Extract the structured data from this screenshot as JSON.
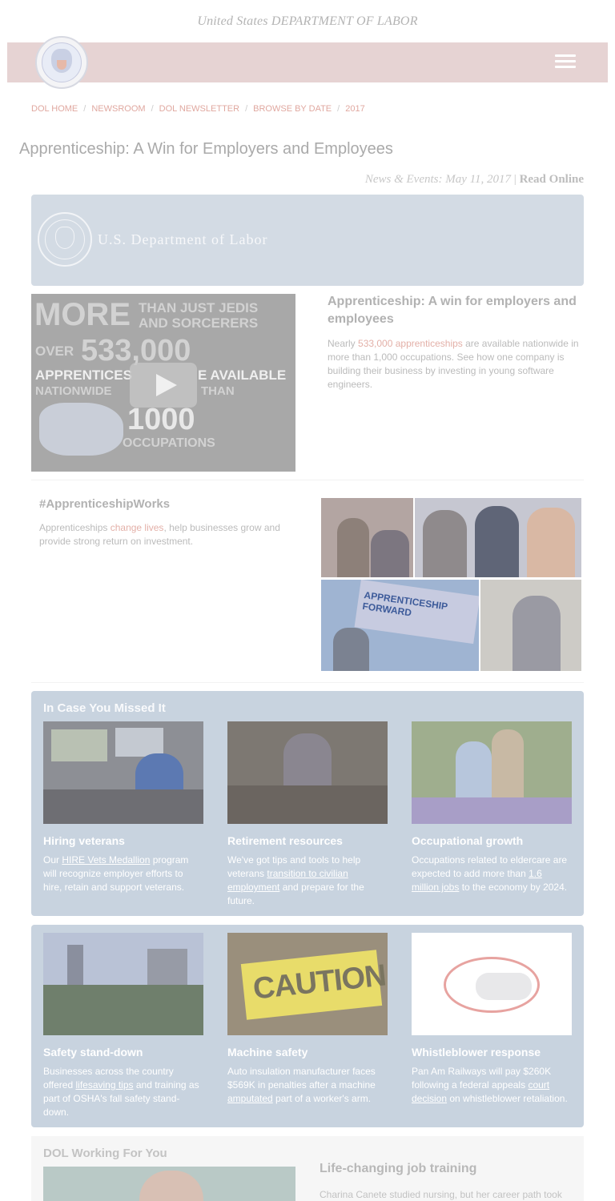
{
  "agency_line": "United States DEPARTMENT OF LABOR",
  "nav": {
    "menu_icon": "hamburger-icon",
    "logo": "dol-seal"
  },
  "breadcrumb": {
    "items": [
      "DOL HOME",
      "NEWSROOM",
      "DOL NEWSLETTER",
      "BROWSE BY DATE",
      "2017"
    ],
    "separator": "/"
  },
  "page_title": "Apprenticeship: A Win for Employers and Employees",
  "news_line": {
    "prefix": "News & Events: May 11, 2017",
    "divider": "|",
    "link": "Read Online"
  },
  "banner": {
    "title": "U.S. Department of Labor"
  },
  "video": {
    "line1": "MORE",
    "line1b": "THAN JUST JEDIS",
    "line1c": "AND SORCERERS",
    "line2a": "OVER",
    "line2b": "533,000",
    "line3": "APPRENTICES",
    "line3b": "E AVAILABLE",
    "line4": "NATIONWIDE",
    "line4b": "THAN",
    "line5": "1000",
    "line6": "OCCUPATIONS",
    "play_icon": "play-icon"
  },
  "feature": {
    "heading": "Apprenticeship: A win for employers and employees",
    "text_before": "Nearly ",
    "link": "533,000 apprenticeships",
    "text_after": " are available nationwide in more than 1,000 occupations. See how one company is building their business by investing in young software engineers."
  },
  "apprenticeship_works": {
    "heading": "#ApprenticeshipWorks",
    "text_before": "Apprenticeships ",
    "link": "change lives",
    "text_after": ", help businesses grow and provide strong return on investment."
  },
  "collage": {
    "sign_text": "APPRENTICESHIP FORWARD"
  },
  "missed": {
    "heading": "In Case You Missed It",
    "cards": [
      {
        "title": "Hiring veterans",
        "p1": "Our ",
        "link": "HIRE Vets Medallion",
        "p2": " program will recognize employer efforts to hire, retain and support veterans."
      },
      {
        "title": "Retirement resources",
        "p1": "We've got tips and tools to help veterans ",
        "link": "transition to civilian employment",
        "p2": " and prepare for the future."
      },
      {
        "title": "Occupational growth",
        "p1": "Occupations related to eldercare are expected to add more than ",
        "link": "1.6 million jobs",
        "p2": " to the economy by 2024."
      }
    ]
  },
  "more": {
    "cards": [
      {
        "title": "Safety stand-down",
        "p1": "Businesses across the country offered ",
        "link": "lifesaving tips",
        "p2": " and training as part of OSHA's fall safety stand-down."
      },
      {
        "title": "Machine safety",
        "p1": "Auto insulation manufacturer faces $569K in penalties after a machine ",
        "link": "amputated",
        "p2": " part of a worker's arm."
      },
      {
        "title": "Whistleblower response",
        "p1": "Pan Am Railways will pay $260K following a federal appeals ",
        "link": "court decision",
        "p2": " on whistleblower retaliation."
      }
    ],
    "caution_text": "CAUTION"
  },
  "dol_working": {
    "heading": "DOL Working For You",
    "title": "Life-changing job training",
    "text": "Charina Canete studied nursing, but her career path took"
  }
}
